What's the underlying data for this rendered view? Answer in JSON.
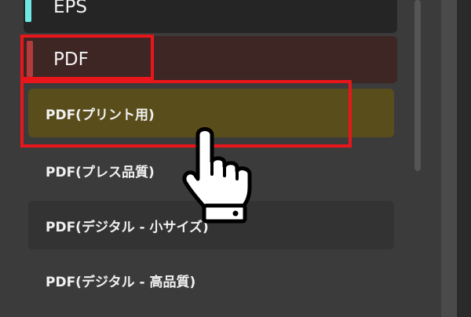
{
  "menu": {
    "eps_label": "EPS",
    "pdf_label": "PDF",
    "sub_items": [
      {
        "label": "PDF(プリント用)",
        "state": "hovered"
      },
      {
        "label": "PDF(プレス品質)",
        "state": "normal"
      },
      {
        "label": "PDF(デジタル - 小サイズ)",
        "state": "normal"
      },
      {
        "label": "PDF(デジタル - 高品質)",
        "state": "normal"
      }
    ]
  },
  "colors": {
    "eps_accent": "#6fe8e3",
    "pdf_accent": "#b23c3c",
    "hover_bg": "#5a4d1c",
    "highlight": "#e8161a"
  },
  "icons": {
    "pointer": "pointing-hand-icon"
  }
}
